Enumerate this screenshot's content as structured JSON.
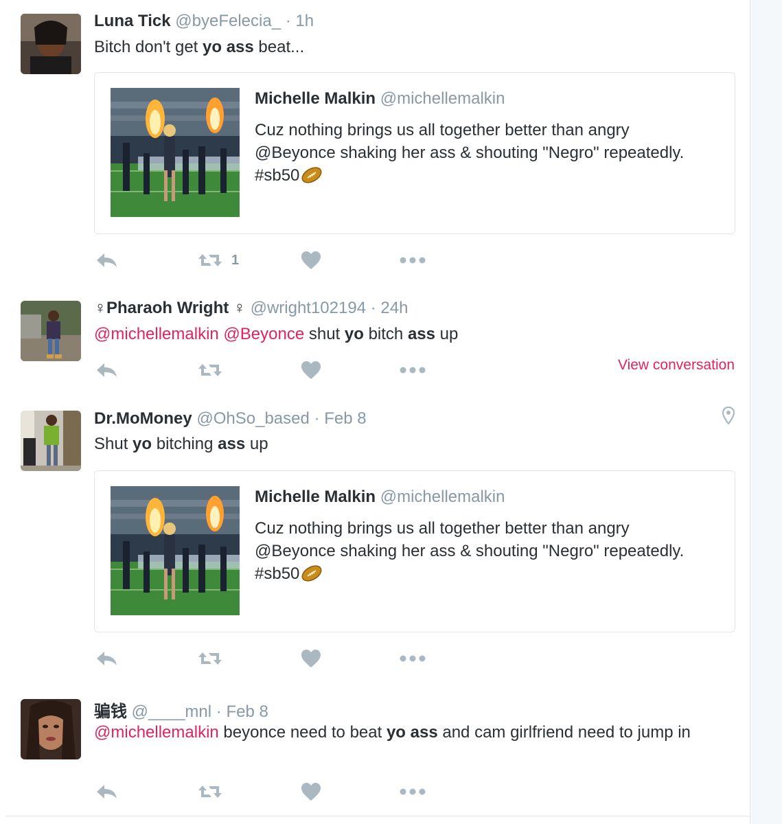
{
  "tweets": [
    {
      "name": "Luna Tick",
      "handle": "@byeFelecia_",
      "time": "1h",
      "text": [
        "Bitch don't get ",
        "yo",
        " ",
        "ass",
        " beat..."
      ],
      "retweet_count": "1",
      "quote": {
        "name": "Michelle Malkin",
        "handle": "@michellemalkin",
        "text": "Cuz nothing brings us all together better than angry @Beyonce shaking her ass & shouting \"Negro\" repeatedly. #sb50"
      }
    },
    {
      "name": "♀Pharaoh Wright ♀",
      "handle": "@wright102194",
      "time": "24h",
      "mention1": "@michellemalkin",
      "mention2": "@Beyonce",
      "text": [
        " shut ",
        "yo",
        " bitch ",
        "ass",
        " up"
      ],
      "view_conversation": "View conversation"
    },
    {
      "name": "Dr.MoMoney",
      "handle": "@OhSo_based",
      "time": "Feb 8",
      "text": [
        "Shut ",
        "yo",
        " bitching ",
        "ass",
        " up"
      ],
      "quote": {
        "name": "Michelle Malkin",
        "handle": "@michellemalkin",
        "text": "Cuz nothing brings us all together better than angry @Beyonce shaking her ass & shouting \"Negro\" repeatedly. #sb50"
      }
    },
    {
      "name": "骗钱",
      "handle": "@____mnl",
      "time": "Feb 8",
      "mention1": "@michellemalkin",
      "text": [
        " beyonce need to beat ",
        "yo",
        " ",
        "ass",
        " and cam girlfriend need to jump in"
      ]
    }
  ],
  "sep": "·",
  "icons": {
    "reply": "reply-icon",
    "retweet": "retweet-icon",
    "like": "heart-icon",
    "more": "more-dots-icon",
    "location": "location-pin-icon",
    "football": "football-emoji"
  },
  "colors": {
    "mention": "#e0245e",
    "muted": "#8899a6",
    "action_icon": "#aab8c2"
  }
}
